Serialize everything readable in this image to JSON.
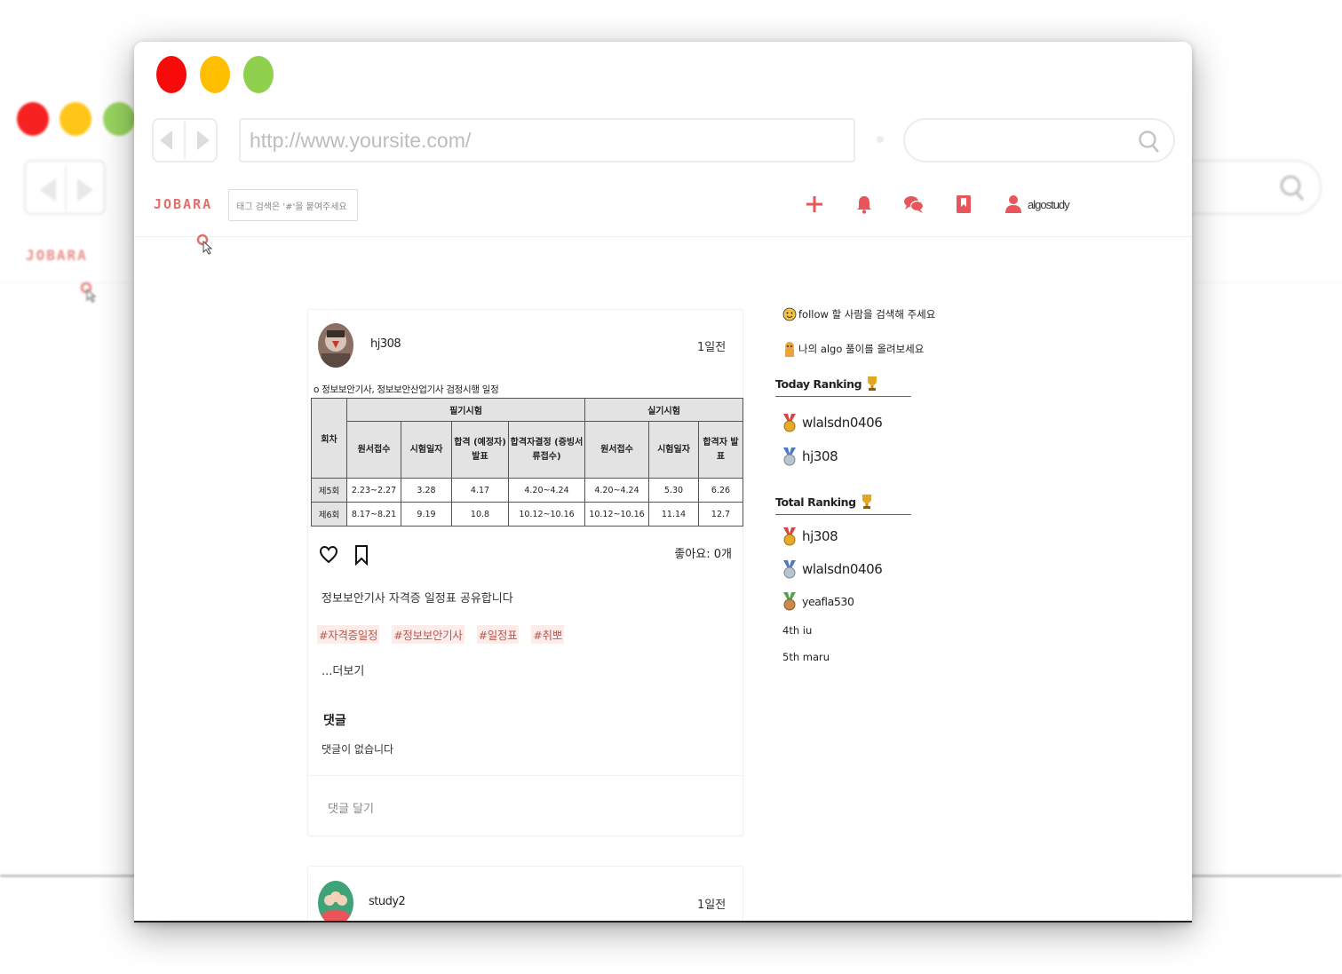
{
  "window": {
    "url": "http://www.yoursite.com/",
    "dot_colors": [
      "#f60a0a",
      "#ffbf00",
      "#8fd14f"
    ]
  },
  "app": {
    "logo": "JOBARA",
    "tag_search_placeholder": "태그 검색은 '#'을 붙여주세요",
    "username": "algostudy",
    "accent": "#e36f6c"
  },
  "post": {
    "user": "hj308",
    "time": "1일전",
    "schedule_title": "o 정보보안기사, 정보보안산업기사 검정시행 일정",
    "table": {
      "col_round": "회차",
      "group_written": "필기시험",
      "group_practical": "실기시험",
      "headers": [
        "원서접수",
        "시험일자",
        "합격 (예정자) 발표",
        "합격자결정 (증빙서류접수)",
        "원서접수",
        "시험일자",
        "합격자 발표"
      ],
      "rows": [
        [
          "제5회",
          "2.23~2.27",
          "3.28",
          "4.17",
          "4.20~4.24",
          "4.20~4.24",
          "5.30",
          "6.26"
        ],
        [
          "제6회",
          "8.17~8.21",
          "9.19",
          "10.8",
          "10.12~10.16",
          "10.12~10.16",
          "11.14",
          "12.7"
        ]
      ]
    },
    "likes": "좋아요: 0개",
    "caption": "정보보안기사 자격증 일정표 공유합니다",
    "tags": [
      "#자격증일정",
      "#정보보안기사",
      "#일정표",
      "#취뽀"
    ],
    "more": "...더보기",
    "comments_title": "댓글",
    "comments_empty": "댓글이 없습니다",
    "comment_placeholder": "댓글 달기"
  },
  "post2": {
    "user": "study2",
    "time": "1일전"
  },
  "sidebar": {
    "follow_hint": "follow 할 사람을 검색해 주세요",
    "upload_hint": "나의 algo 풀이를 올려보세요",
    "today_title": "Today Ranking",
    "today": [
      "wlalsdn0406",
      "hj308"
    ],
    "total_title": "Total Ranking",
    "total": [
      "hj308",
      "wlalsdn0406",
      "yeafla530"
    ],
    "total_extra": [
      "4th iu",
      "5th maru"
    ]
  }
}
